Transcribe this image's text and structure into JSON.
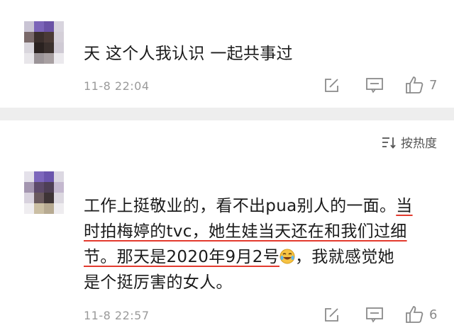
{
  "comments": [
    {
      "text": "天 这个人我认识 一起共事过",
      "time": "11-8 22:04",
      "likes": "7"
    },
    {
      "sort_label": "按热度",
      "lines": [
        {
          "plain": "工作上挺敬业的，看不出pua别人的一面。",
          "underlined": "当"
        },
        {
          "plain": "",
          "underlined": "时拍梅婷的tvc，她生娃当天还在和我们过细"
        },
        {
          "underlined": "节。那天是2020年9月2号",
          "after": "，我就感觉她"
        },
        {
          "plain": "是个挺厉害的女人。"
        }
      ],
      "time": "11-8 22:57",
      "likes": "6"
    }
  ],
  "icons": {
    "share": "share-edit-icon",
    "reply": "comment-bubble-icon",
    "like": "thumbs-up-icon",
    "sort": "sort-icon",
    "emoji": "laughing-tears-emoji"
  },
  "colors": {
    "underline": "#e23a2e",
    "meta": "#9a9a9a",
    "separator": "#eeeeee"
  }
}
